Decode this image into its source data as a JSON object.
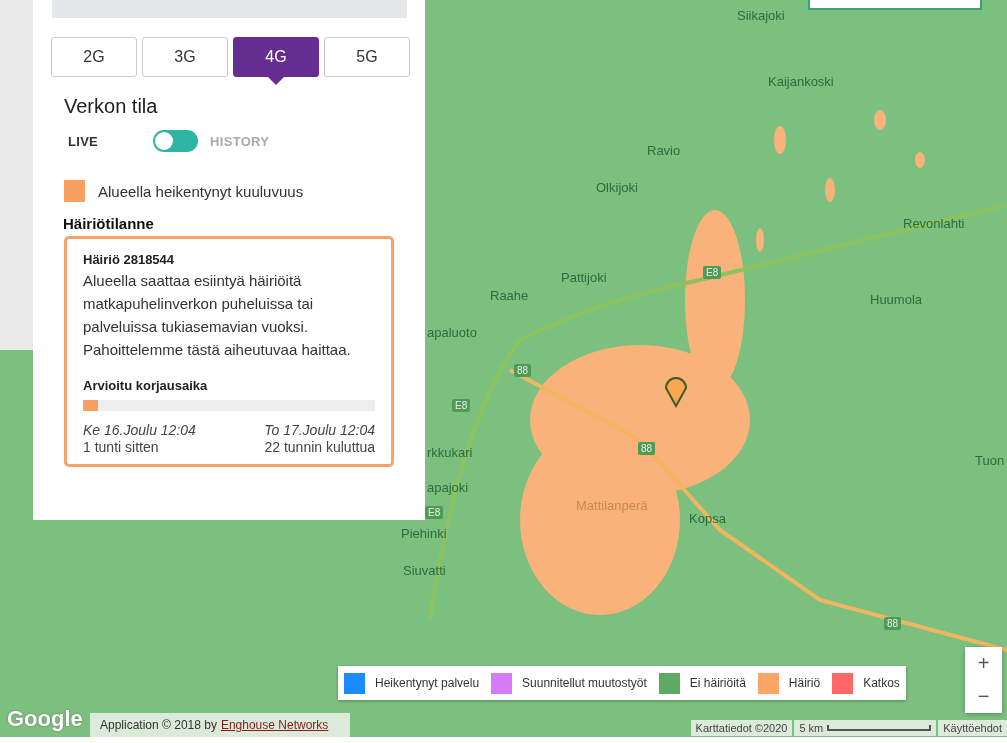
{
  "network_tabs": [
    {
      "label": "2G",
      "selected": false
    },
    {
      "label": "3G",
      "selected": false
    },
    {
      "label": "4G",
      "selected": true
    },
    {
      "label": "5G",
      "selected": false
    }
  ],
  "status_title": "Verkon tila",
  "mode_toggle": {
    "left_label": "LIVE",
    "right_label": "HISTORY",
    "on": false
  },
  "area_legend": {
    "label": "Alueella heikentynyt kuuluvuus",
    "color": "#f9a061"
  },
  "incident_heading": "Häiriötilanne",
  "incident": {
    "title": "Häiriö 2818544",
    "description": "Alueella saattaa esiintyä häiriöitä matkapuhelinverkon puheluissa tai palveluissa tukiasemavian vuoksi. Pahoittelemme tästä aiheutuvaa haittaa.",
    "repair_label": "Arvioitu korjausaika",
    "level": 0.05,
    "start_time": "Ke 16.Joulu 12:04",
    "start_relative": "1 tunti sitten",
    "end_time": "To 17.Joulu 12:04",
    "end_relative": "22 tunnin kuluttua"
  },
  "map_places": [
    "Siikajoki",
    "Kaijankoski",
    "Ravio",
    "Olkijoki",
    "Revonlahti",
    "Pattijoki",
    "Raahe",
    "Huumola",
    "apaluoto",
    "rkkukari",
    "apajoki",
    "Piehinki",
    "Siuvatti",
    "Mattilanperä",
    "Kopsa",
    "Tuon"
  ],
  "road_shields": [
    "E8",
    "88",
    "E8",
    "88",
    "E8",
    "88"
  ],
  "legend": [
    {
      "label": "Heikentynyt palvelu",
      "color": "#1a8cff"
    },
    {
      "label": "Suunnitellut muutostyöt",
      "color": "#d67af5"
    },
    {
      "label": "Ei häiriöitä",
      "color": "#5faa63"
    },
    {
      "label": "Häiriö",
      "color": "#fba567"
    },
    {
      "label": "Katkos",
      "color": "#ff6666"
    }
  ],
  "zoom": {
    "in": "+",
    "out": "−"
  },
  "google_logo": "Google",
  "app_credit": {
    "text": "Application © 2018 by",
    "link": "Enghouse Networks"
  },
  "map_attribution": {
    "data": "Karttatiedot ©2020",
    "scale": "5 km",
    "terms": "Käyttöehdot"
  }
}
